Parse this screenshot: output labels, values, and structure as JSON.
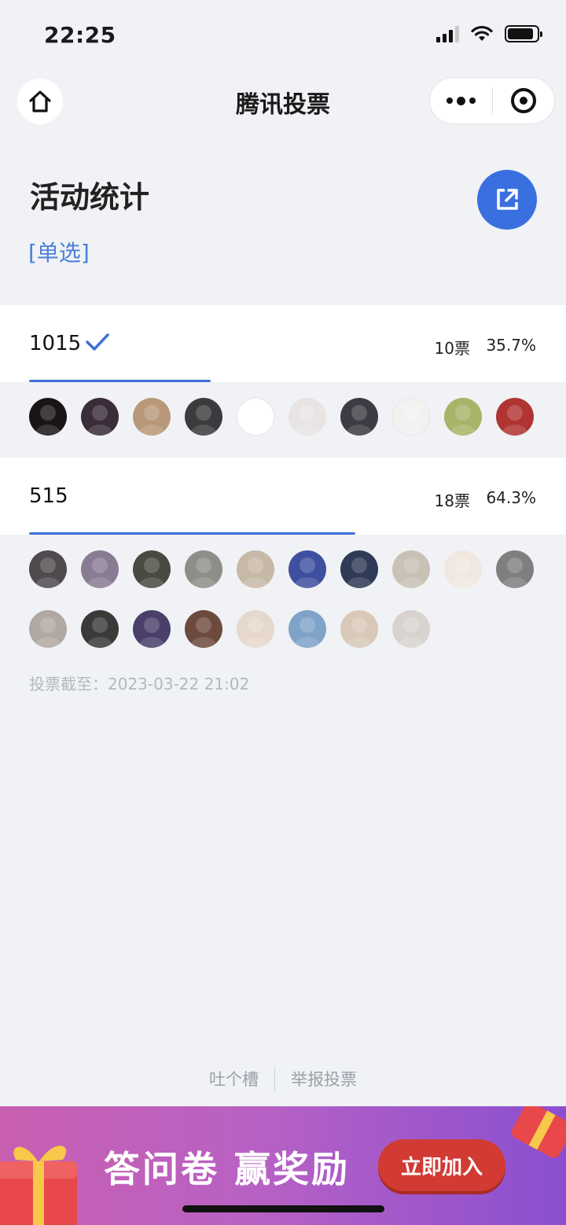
{
  "status_bar": {
    "time": "22:25",
    "battery_level": 0.9,
    "signal_bars": 3
  },
  "nav": {
    "title": "腾讯投票"
  },
  "header": {
    "title": "活动统计",
    "vote_type": "[单选]"
  },
  "options": [
    {
      "name": "1015",
      "votes": "10票",
      "percent": "35.7%",
      "fraction": 0.357,
      "selected": true,
      "avatar_colors": [
        "#1b1416",
        "#3a2c38",
        "#b89878",
        "#3b3b3e",
        "#ffffff",
        "#e8e4e3",
        "#3c3c44",
        "#f2f2f0",
        "#a8b468",
        "#b03432"
      ]
    },
    {
      "name": "515",
      "votes": "18票",
      "percent": "64.3%",
      "fraction": 0.643,
      "selected": false,
      "avatar_colors": [
        "#4f4a4e",
        "#8a7b94",
        "#4a4a40",
        "#8e8e88",
        "#c7b9a7",
        "#3f4fa0",
        "#2f3a56",
        "#c9c0b6",
        "#f0e8e0",
        "#7f7f7f",
        "#b0a8a2",
        "#3a3a38",
        "#4a3f6a",
        "#6d4a3e",
        "#e6d9cc",
        "#7fa3c8",
        "#d8c8b8",
        "#d8d3cf"
      ]
    }
  ],
  "deadline": "投票截至：2023-03-22 21:02",
  "footer": {
    "feedback": "吐个槽",
    "report": "举报投票"
  },
  "banner": {
    "text": "答问卷 赢奖励",
    "button": "立即加入"
  },
  "colors": {
    "accent": "#3a6fe0",
    "progress": "#3f6fd8",
    "background": "#f0f2f5",
    "banner_button": "#d23a34"
  }
}
